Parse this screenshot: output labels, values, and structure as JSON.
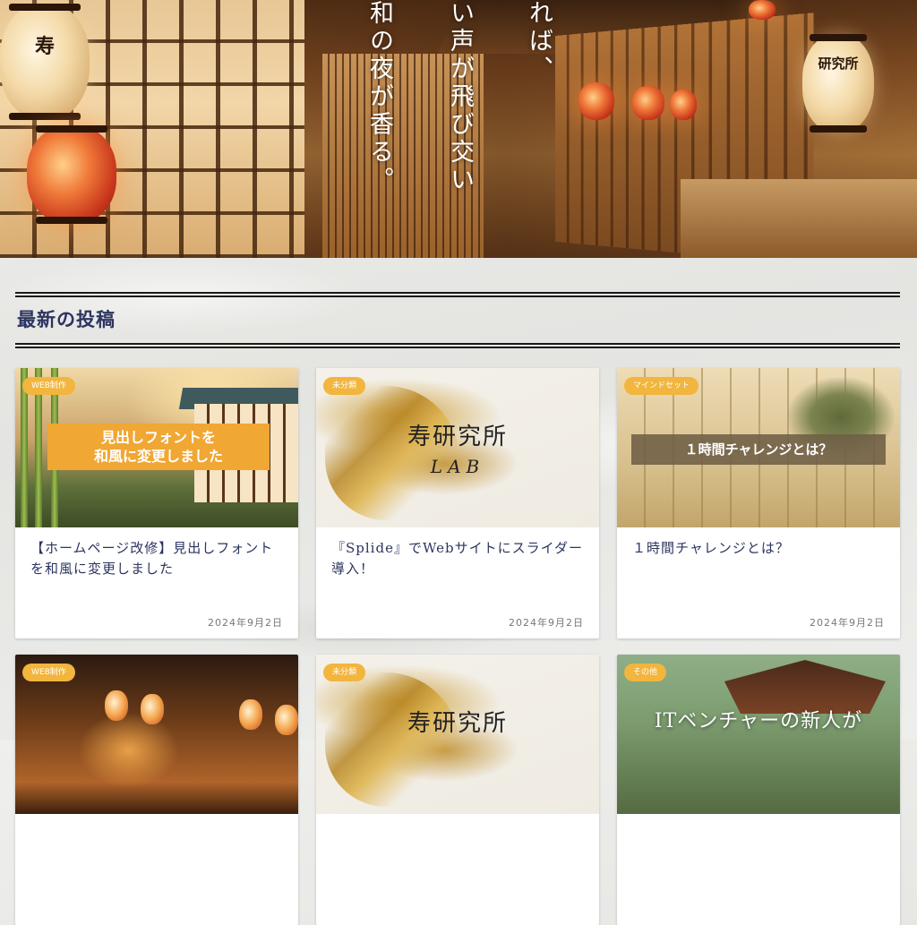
{
  "hero": {
    "line1": "れば、",
    "line2": "い声が飛び交い",
    "line3": "和の夜が香る。",
    "lantern_left_glyph": "寿",
    "lantern_right_glyph": "研究所"
  },
  "section": {
    "title": "最新の投稿"
  },
  "posts": [
    {
      "category": "WEB制作",
      "thumb_banner_line1": "見出しフォントを",
      "thumb_banner_line2": "和風に変更しました",
      "title": "【ホームページ改修】見出しフォントを和風に変更しました",
      "date": "2024年9月2日"
    },
    {
      "category": "未分類",
      "thumb_logo_main": "寿研究所",
      "thumb_logo_sub": "LAB",
      "title": "『Splide』でWebサイトにスライダー導入！",
      "date": "2024年9月2日"
    },
    {
      "category": "マインドセット",
      "thumb_bar": "１時間チャレンジとは？",
      "title": "１時間チャレンジとは？",
      "date": "2024年9月2日"
    },
    {
      "category": "WEB制作"
    },
    {
      "category": "未分類",
      "thumb_logo_main": "寿研究所"
    },
    {
      "category": "その他",
      "thumb_caption": "ITベンチャーの新人が"
    }
  ]
}
